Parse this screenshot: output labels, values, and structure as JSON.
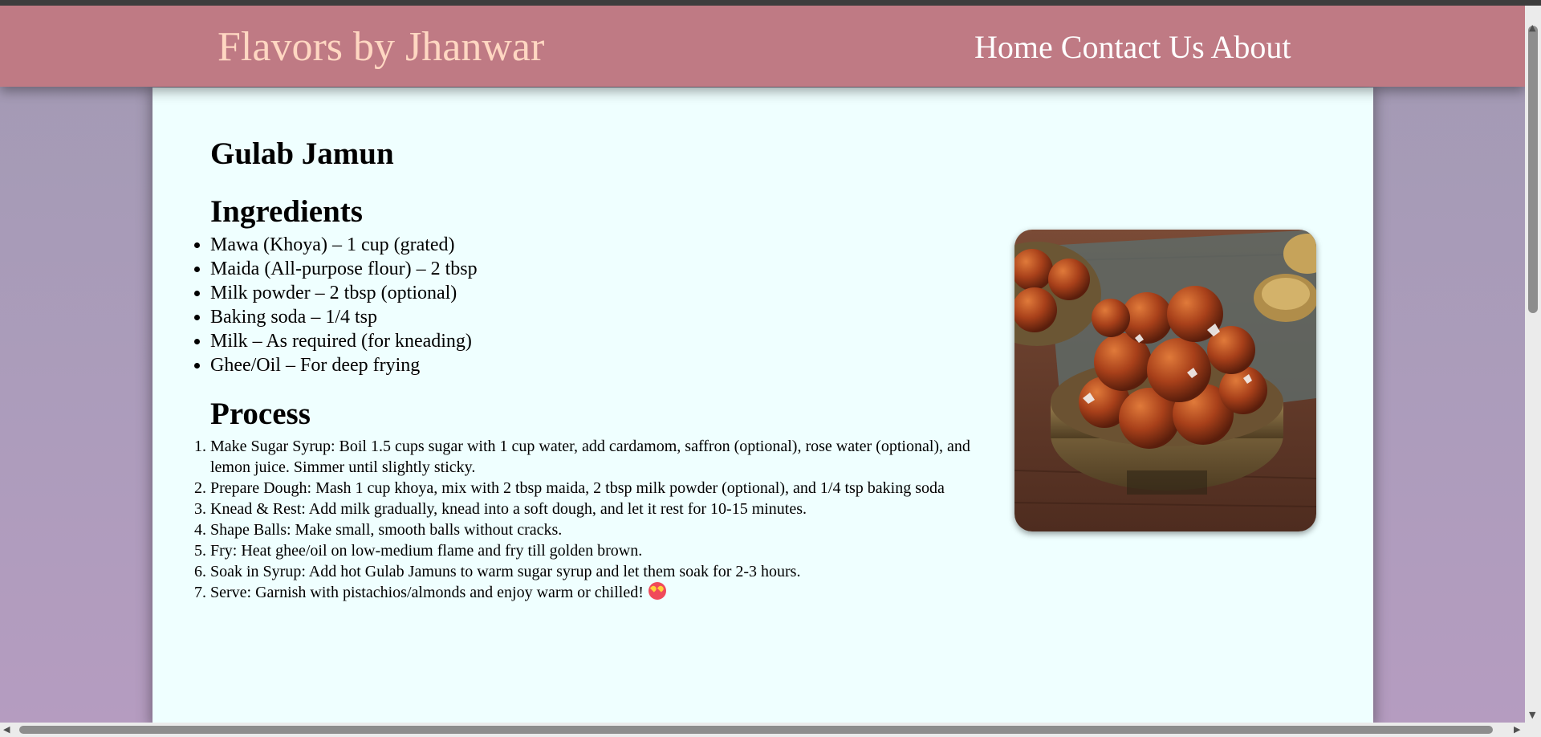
{
  "header": {
    "brand": "Flavors by Jhanwar",
    "nav": [
      "Home",
      "Contact Us",
      "About"
    ]
  },
  "recipe": {
    "title": "Gulab Jamun",
    "ingredients_heading": "Ingredients",
    "ingredients": [
      "Mawa (Khoya) – 1 cup (grated)",
      "Maida (All-purpose flour) – 2 tbsp",
      "Milk powder – 2 tbsp (optional)",
      "Baking soda – 1/4 tsp",
      "Milk – As required (for kneading)",
      "Ghee/Oil – For deep frying"
    ],
    "process_heading": "Process",
    "steps": [
      "Make Sugar Syrup: Boil 1.5 cups sugar with 1 cup water, add cardamom, saffron (optional), rose water (optional), and lemon juice. Simmer until slightly sticky.",
      "Prepare Dough: Mash 1 cup khoya, mix with 2 tbsp maida, 2 tbsp milk powder (optional), and 1/4 tsp baking soda",
      "Knead & Rest: Add milk gradually, knead into a soft dough, and let it rest for 10-15 minutes.",
      "Shape Balls: Make small, smooth balls without cracks.",
      "Fry: Heat ghee/oil on low-medium flame and fry till golden brown.",
      "Soak in Syrup: Add hot Gulab Jamuns to warm sugar syrup and let them soak for 2-3 hours.",
      "Serve: Garnish with pistachios/almonds and enjoy warm or chilled!"
    ],
    "step7_emoji_icon": "heart-eyes-emoji-icon"
  },
  "colors": {
    "header_bg": "#bf7a84",
    "brand_text": "#ffd7c2",
    "card_bg": "#efffff"
  },
  "scrollbar_arrows": {
    "up": "▲",
    "down": "▼",
    "left": "◀",
    "right": "▶"
  }
}
